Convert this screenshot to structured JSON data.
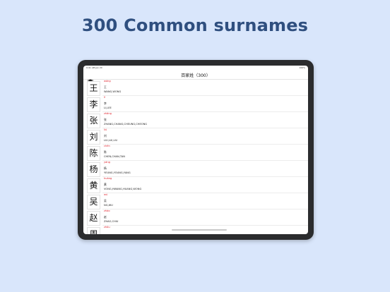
{
  "headline": "300 Common surnames",
  "status": {
    "time": "9:41 AM  Jan 20",
    "battery": "100%"
  },
  "nav": {
    "title": "百家姓（300）",
    "menu_icon": "menu-icon"
  },
  "rows": [
    {
      "char": "王",
      "pinyin": "wáng",
      "hanzi": "王",
      "roman": "WANG,WONG"
    },
    {
      "char": "李",
      "pinyin": "lǐ",
      "hanzi": "李",
      "roman": "LI,LEE"
    },
    {
      "char": "张",
      "pinyin": "zhāng",
      "hanzi": "张",
      "roman": "ZHANG,CHANG,CHEUNG,CHEONG"
    },
    {
      "char": "刘",
      "pinyin": "liú",
      "hanzi": "刘",
      "roman": "LIU,LUI,LIU"
    },
    {
      "char": "陈",
      "pinyin": "chén",
      "hanzi": "陈",
      "roman": "CHEN,CHAN,TAN"
    },
    {
      "char": "杨",
      "pinyin": "yáng",
      "hanzi": "杨",
      "roman": "YEUNG,YOUNG,YANG"
    },
    {
      "char": "黄",
      "pinyin": "huáng",
      "hanzi": "黄",
      "roman": "VONG,HWANG,HUANG,WONG"
    },
    {
      "char": "吴",
      "pinyin": "wú",
      "hanzi": "吴",
      "roman": "NG,WU"
    },
    {
      "char": "赵",
      "pinyin": "zhào",
      "hanzi": "赵",
      "roman": "ZHAO,CHIU"
    },
    {
      "char": "周",
      "pinyin": "zhōu",
      "hanzi": "",
      "roman": ""
    }
  ]
}
